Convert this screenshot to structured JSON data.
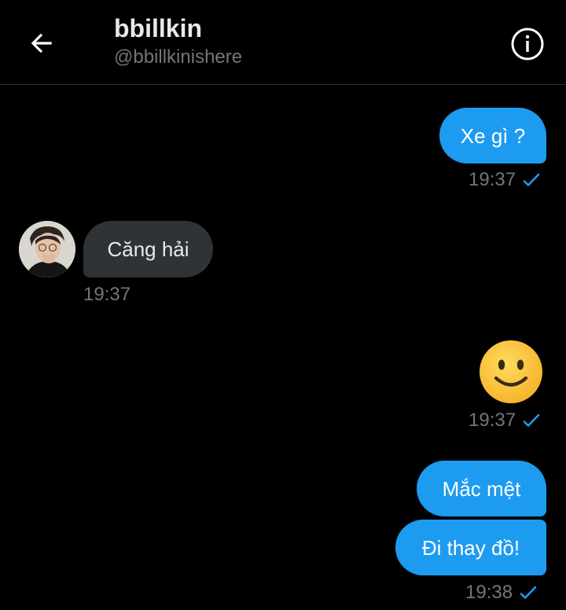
{
  "header": {
    "title": "bbillkin",
    "handle": "@bbillkinishere"
  },
  "icons": {
    "back": "arrow-left-icon",
    "info": "info-circle-icon",
    "read": "checkmark-icon",
    "emoji": "slightly-smiling-face-emoji"
  },
  "colors": {
    "background": "#000000",
    "outgoing_bubble": "#1d9bf0",
    "incoming_bubble": "#2f3336",
    "timestamp": "#71767b",
    "check": "#1d9bf0"
  },
  "messages": [
    {
      "text": "Xe gì ?",
      "time": "19:37"
    },
    {
      "text": "Căng hải",
      "time": "19:37"
    },
    {
      "emoji": "🙂",
      "time": "19:37"
    },
    {
      "text": "Mắc mệt"
    },
    {
      "text": "Đi thay đồ!",
      "time": "19:38"
    }
  ]
}
